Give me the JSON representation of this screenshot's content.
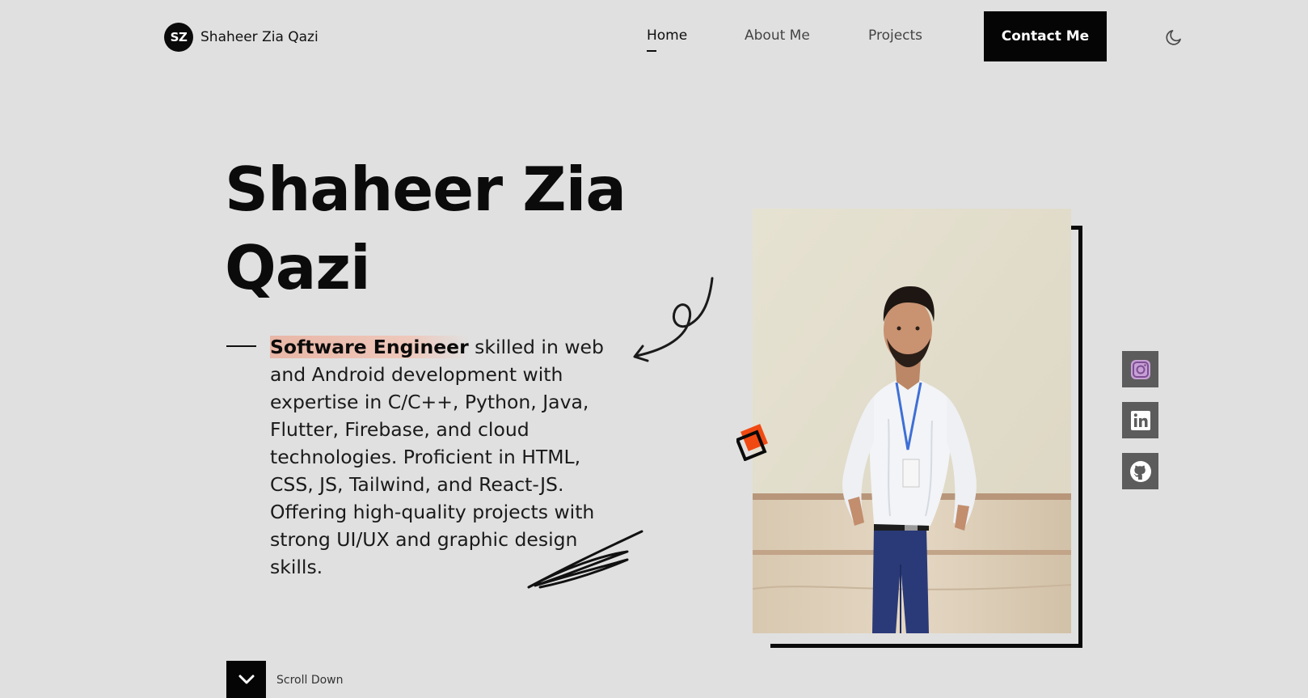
{
  "header": {
    "logo_initials": "SZ",
    "logo_name": "Shaheer Zia Qazi",
    "nav": [
      {
        "label": "Home",
        "active": true
      },
      {
        "label": "About Me",
        "active": false
      },
      {
        "label": "Projects",
        "active": false
      }
    ],
    "contact_label": "Contact Me",
    "theme_icon": "moon-icon"
  },
  "hero": {
    "title": "Shaheer Zia Qazi",
    "highlight": "Software Engineer",
    "description": " skilled in web and Android development with expertise in C/C++, Python, Java, Flutter, Firebase, and cloud technologies. Proficient in HTML, CSS, JS, Tailwind, and React-JS. Offering high-quality projects with strong UI/UX and graphic design skills."
  },
  "socials": [
    {
      "name": "instagram",
      "icon": "instagram-icon"
    },
    {
      "name": "linkedin",
      "icon": "linkedin-icon"
    },
    {
      "name": "github",
      "icon": "github-icon"
    }
  ],
  "scroll": {
    "label": "Scroll Down",
    "icon": "chevron-down-icon"
  },
  "colors": {
    "background": "#e0e0e0",
    "primary": "#050505",
    "accent": "#f04a12",
    "highlight": "#e8b6a6",
    "social_bg": "#5c5c5c"
  }
}
